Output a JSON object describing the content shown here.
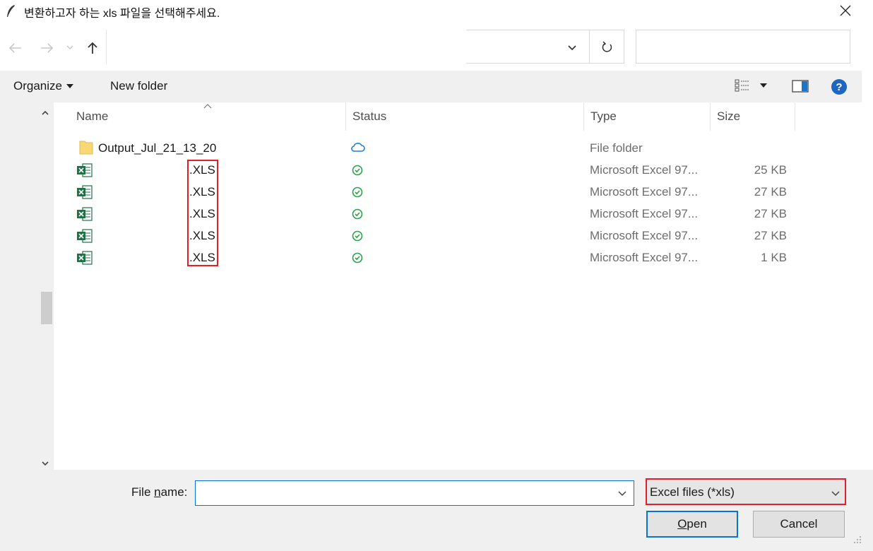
{
  "window": {
    "title": "변환하고자 하는 xls 파일을 선택해주세요.",
    "title_icon": "feather-icon",
    "close_icon": "close-icon"
  },
  "nav": {
    "back_icon": "arrow-left-icon",
    "forward_icon": "arrow-right-icon",
    "recent_icon": "chevron-down-icon",
    "up_icon": "arrow-up-icon",
    "address_value": "",
    "address_dropdown_icon": "chevron-down-icon",
    "refresh_icon": "refresh-icon",
    "search_placeholder": ""
  },
  "toolbar": {
    "organize_label": "Organize",
    "new_folder_label": "New folder",
    "view_icon": "view-list-icon",
    "preview_icon": "preview-pane-icon",
    "help_icon": "help-icon"
  },
  "columns": {
    "name": "Name",
    "status": "Status",
    "type": "Type",
    "size": "Size"
  },
  "files": [
    {
      "icon": "folder-icon",
      "name": "Output_Jul_21_13_20",
      "status_icon": "cloud-icon",
      "type": "File folder",
      "size": ""
    },
    {
      "icon": "excel-file-icon",
      "name": ".XLS",
      "status_icon": "synced-check-icon",
      "type": "Microsoft Excel 97...",
      "size": "25 KB"
    },
    {
      "icon": "excel-file-icon",
      "name": ".XLS",
      "status_icon": "synced-check-icon",
      "type": "Microsoft Excel 97...",
      "size": "27 KB"
    },
    {
      "icon": "excel-file-icon",
      "name": ".XLS",
      "status_icon": "synced-check-icon",
      "type": "Microsoft Excel 97...",
      "size": "27 KB"
    },
    {
      "icon": "excel-file-icon",
      "name": ".XLS",
      "status_icon": "synced-check-icon",
      "type": "Microsoft Excel 97...",
      "size": "27 KB"
    },
    {
      "icon": "excel-file-icon",
      "name": ".XLS",
      "status_icon": "synced-check-icon",
      "type": "Microsoft Excel 97...",
      "size": "1 KB"
    }
  ],
  "bottom": {
    "file_name_label_pre": "File ",
    "file_name_label_accel": "n",
    "file_name_label_post": "ame:",
    "file_name_value": "",
    "filter_value": "Excel files (*xls)",
    "open_label_accel": "O",
    "open_label_post": "pen",
    "cancel_label": "Cancel"
  },
  "colors": {
    "highlight_red": "#e0202a",
    "focus_blue": "#0a74d6",
    "excel_green": "#1d7145",
    "folder_yellow": "#f8d775",
    "status_green": "#2aa24a",
    "cloud_blue": "#1f7fd8"
  }
}
